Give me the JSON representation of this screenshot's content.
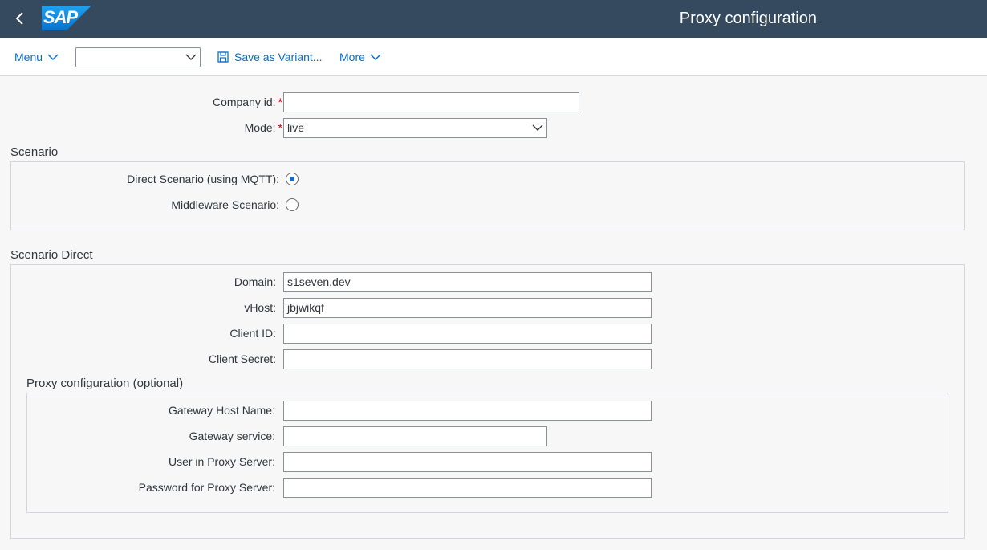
{
  "shell": {
    "title": "Proxy configuration",
    "logo_text": "SAP",
    "back_icon": "chevron-left-icon",
    "colors": {
      "shell_bg": "#354a5f",
      "logo_blue": "#1c8ee0",
      "accent": "#0a6ed1",
      "required": "#bb0000"
    }
  },
  "toolbar": {
    "menu_label": "Menu",
    "variant_value": "",
    "save_variant_label": "Save as Variant...",
    "more_label": "More"
  },
  "form": {
    "company_id": {
      "label": "Company id:",
      "value": ""
    },
    "mode": {
      "label": "Mode:",
      "value": "live"
    }
  },
  "scenario": {
    "title": "Scenario",
    "direct": {
      "label": "Direct Scenario (using MQTT):",
      "selected": true
    },
    "middleware": {
      "label": "Middleware Scenario:",
      "selected": false
    }
  },
  "scenario_direct": {
    "title": "Scenario Direct",
    "domain": {
      "label": "Domain:",
      "value": "s1seven.dev"
    },
    "vhost": {
      "label": "vHost:",
      "value": "jbjwikqf"
    },
    "client_id": {
      "label": "Client ID:",
      "value": ""
    },
    "client_secret": {
      "label": "Client Secret:",
      "value": ""
    }
  },
  "proxy": {
    "title": "Proxy configuration (optional)",
    "gateway_host": {
      "label": "Gateway Host Name:",
      "value": ""
    },
    "gateway_service": {
      "label": "Gateway service:",
      "value": ""
    },
    "proxy_user": {
      "label": "User in Proxy Server:",
      "value": ""
    },
    "proxy_password": {
      "label": "Password for Proxy Server:",
      "value": ""
    }
  }
}
